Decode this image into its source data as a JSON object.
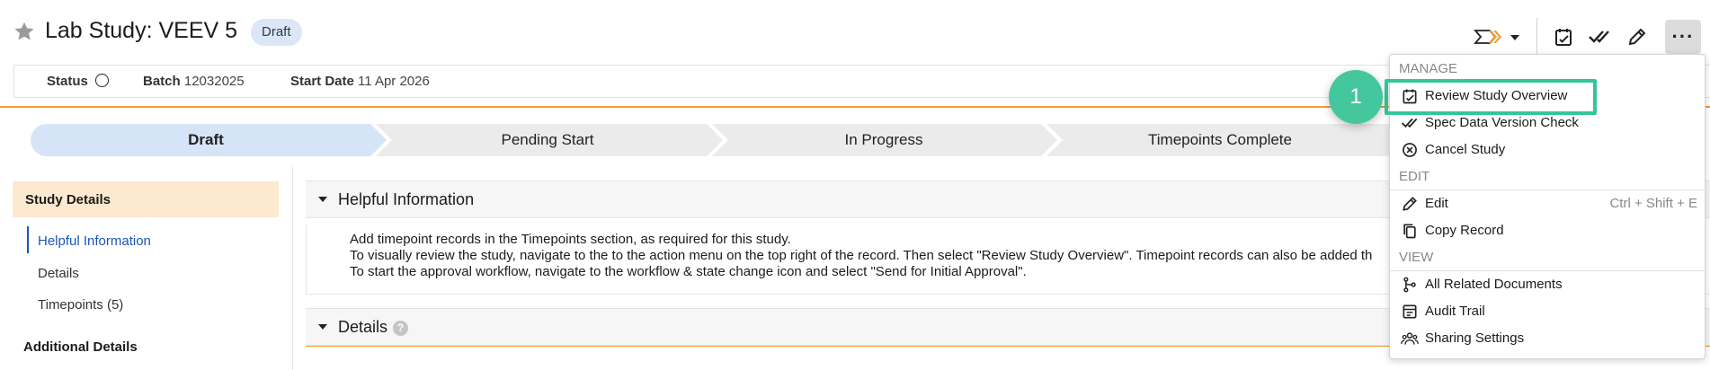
{
  "header": {
    "title": "Lab Study: VEEV 5",
    "badge": "Draft"
  },
  "statusbar": {
    "status_label": "Status",
    "batch_label": "Batch",
    "batch_value": "12032025",
    "start_date_label": "Start Date",
    "start_date_value": "11 Apr 2026"
  },
  "lifecycle": {
    "stages": [
      {
        "label": "Draft",
        "active": true
      },
      {
        "label": "Pending Start",
        "active": false
      },
      {
        "label": "In Progress",
        "active": false
      },
      {
        "label": "Timepoints Complete",
        "active": false
      }
    ]
  },
  "leftnav": {
    "section": "Study Details",
    "items": [
      "Helpful Information",
      "Details",
      "Timepoints (5)"
    ],
    "section2": "Additional Details"
  },
  "panels": {
    "helpful": {
      "title": "Helpful Information",
      "bullets": [
        "Add timepoint records in the Timepoints section, as required for this study.",
        "To visually review the study, navigate to the to the action menu on the top right of the record. Then select \"Review Study Overview\". Timepoint records can also be added th",
        "To start the approval workflow, navigate to the workflow & state change icon and select \"Send for Initial Approval\"."
      ]
    },
    "details": {
      "title": "Details",
      "help_glyph": "?"
    }
  },
  "menu": {
    "groups": {
      "manage": "MANAGE",
      "edit": "EDIT",
      "view": "VIEW"
    },
    "items": {
      "review": "Review Study Overview",
      "spec": "Spec Data Version Check",
      "cancel": "Cancel Study",
      "edit": "Edit",
      "edit_shortcut": "Ctrl + Shift + E",
      "copy": "Copy Record",
      "related": "All Related Documents",
      "audit": "Audit Trail",
      "sharing": "Sharing Settings"
    }
  },
  "more_glyph": "···",
  "step_marker": "1",
  "colors": {
    "accent_orange": "#f39a33",
    "draft_badge_bg": "#dbe6f6",
    "active_stage": "#d6e4f7",
    "inactive_stage": "#ebebeb",
    "highlight_green": "#34c59a",
    "link_blue": "#1a56b8"
  },
  "icons": [
    "star-icon",
    "workflow-icon",
    "chevron-down-icon",
    "review-icon",
    "checkmarks-icon",
    "pencil-icon",
    "more-icon",
    "cancel-icon",
    "copy-icon",
    "related-docs-icon",
    "audit-trail-icon",
    "sharing-icon",
    "caret-down-icon",
    "help-icon"
  ]
}
